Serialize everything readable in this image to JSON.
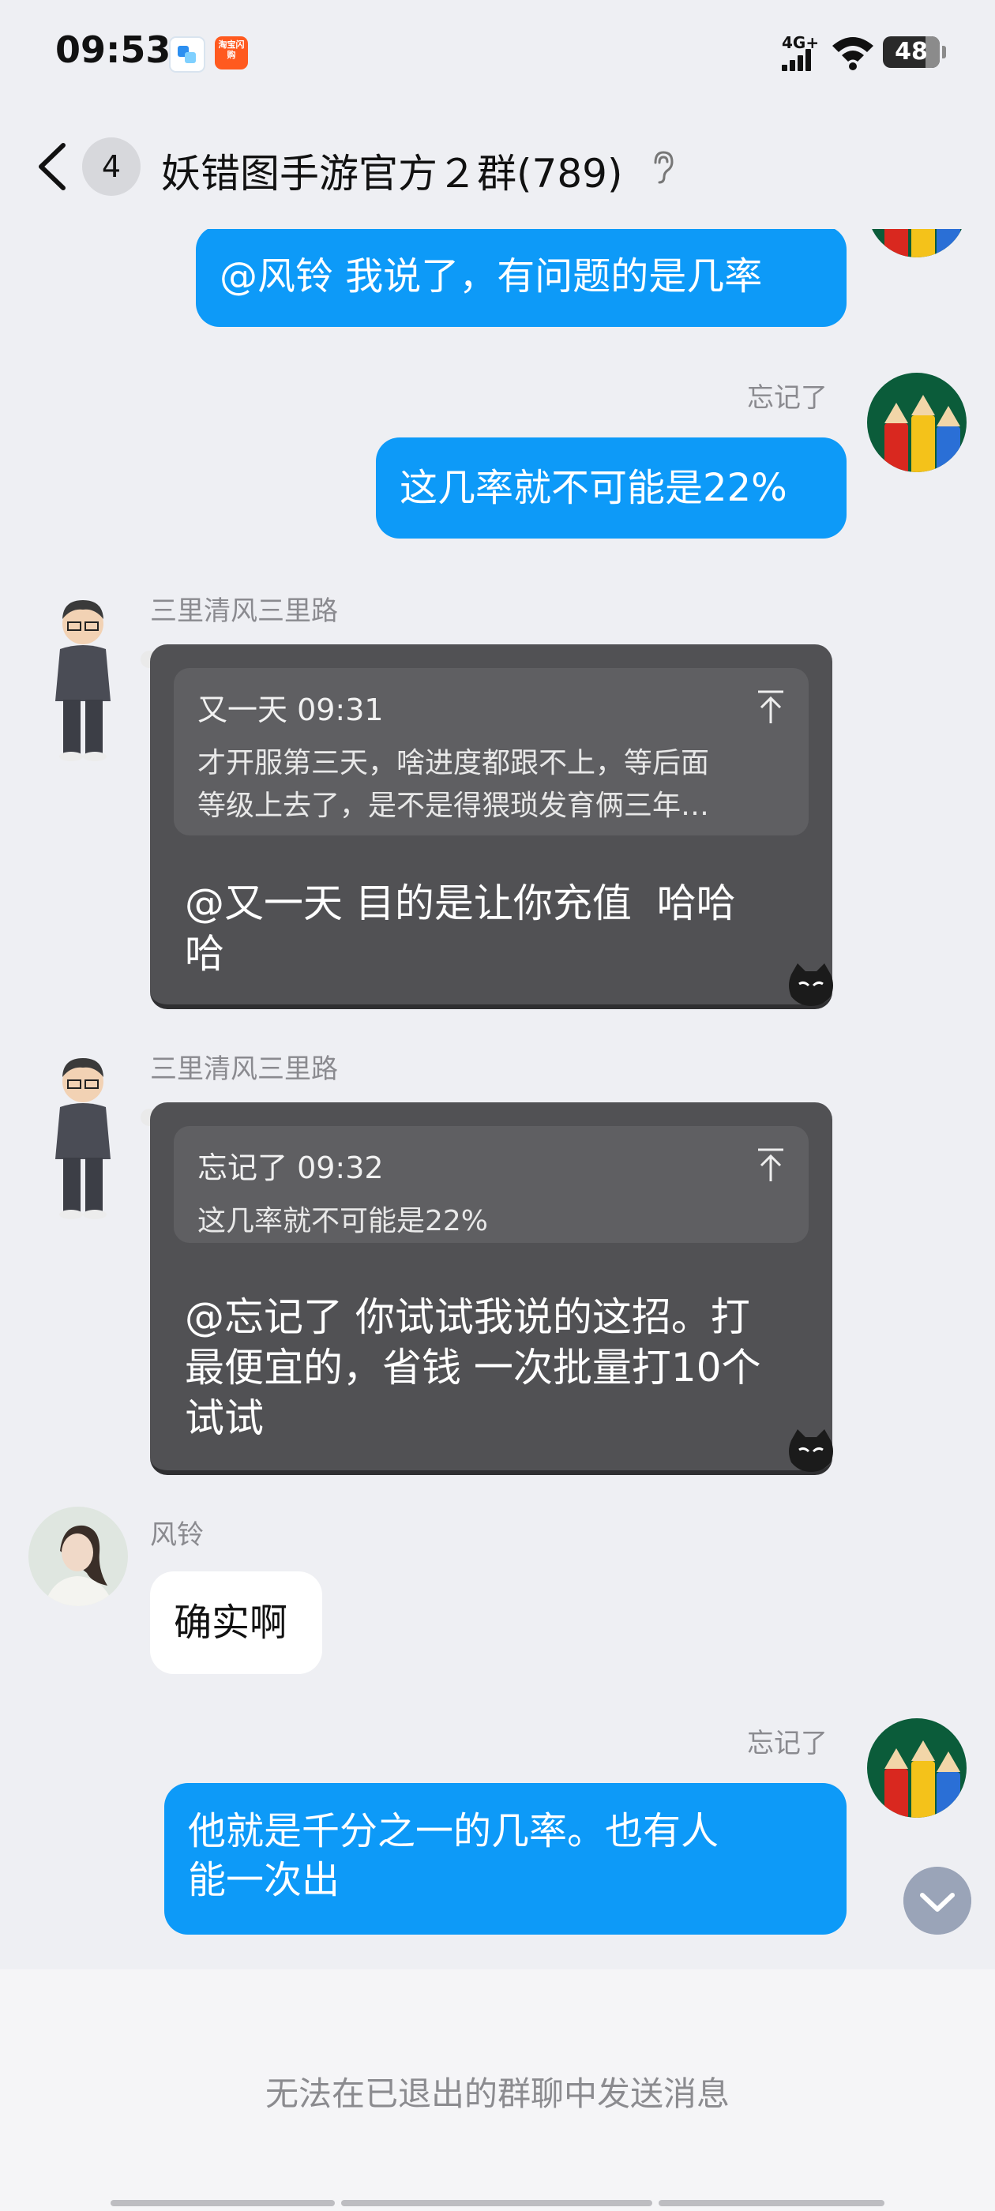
{
  "status_bar": {
    "time": "09:53",
    "network": "4G+",
    "battery": "48",
    "app_badge_text": "淘宝闪购"
  },
  "header": {
    "unread_count": "4",
    "title": "妖错图手游官方２群(789)",
    "icons": [
      "back-icon",
      "ear-icon"
    ]
  },
  "messages": [
    {
      "side": "right",
      "text": "@风铃 我说了，有问题的是几率"
    },
    {
      "side": "right",
      "sender": "忘记了",
      "text": "这几率就不可能是22%"
    },
    {
      "side": "left",
      "sender": "三里清风三里路",
      "quote": {
        "author_time": "又一天 09:31",
        "text": "才开服第三天，啥进度都跟不上，等后面\n等级上去了，是不是得猥琐发育俩三年…"
      },
      "text": "@又一天 目的是让你充值  哈哈\n哈"
    },
    {
      "side": "left",
      "sender": "三里清风三里路",
      "quote": {
        "author_time": "忘记了 09:32",
        "text": "这几率就不可能是22%"
      },
      "text": "@忘记了 你试试我说的这招。打\n最便宜的，省钱 一次批量打10个\n试试"
    },
    {
      "side": "left",
      "sender": "风铃",
      "text": "确实啊"
    },
    {
      "side": "right",
      "sender": "忘记了",
      "text": "他就是千分之一的几率。也有人\n能一次出"
    }
  ],
  "footer": {
    "disabled_text": "无法在已退出的群聊中发送消息"
  },
  "colors": {
    "blue_bubble": "#0d9af8",
    "background": "#eeeff3",
    "dark_card": "#515154"
  }
}
